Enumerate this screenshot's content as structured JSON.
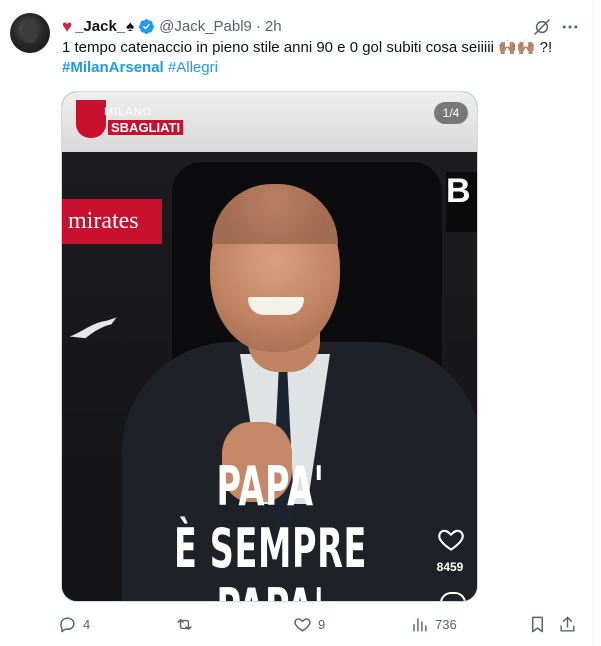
{
  "user": {
    "display_name": "_Jack_",
    "handle": "@Jack_Pabl9",
    "time": "2h",
    "separator": "·"
  },
  "tweet": {
    "text": "1 tempo catenaccio in pieno stile anni 90 e 0 gol subiti cosa seiiiii",
    "emoji": "🙌🏽🙌🏽",
    "text_suffix": "?!",
    "hashtag_1": "#MilanArsenal",
    "hashtag_2": "#Allegri"
  },
  "media": {
    "pager": "1/4",
    "logo_top": "MILANO",
    "logo_bottom": "SBAGLIATI",
    "sponsor": "mirates",
    "brand": "PUMA",
    "caption_line1": "PAPA'",
    "caption_line2": "È SEMPRE PAPA'",
    "overlay_likes": "8459"
  },
  "actions": {
    "replies": "4",
    "reposts": "",
    "likes": "9",
    "views": "736"
  },
  "icons": [
    "heart-icon",
    "spade-icon",
    "verified-icon",
    "grok-icon",
    "more-icon",
    "reply-icon",
    "repost-icon",
    "like-icon",
    "views-icon",
    "bookmark-icon",
    "share-icon"
  ],
  "colors": {
    "accent": "#1d9bf0",
    "muted": "#536471",
    "heart": "#d0243d"
  }
}
